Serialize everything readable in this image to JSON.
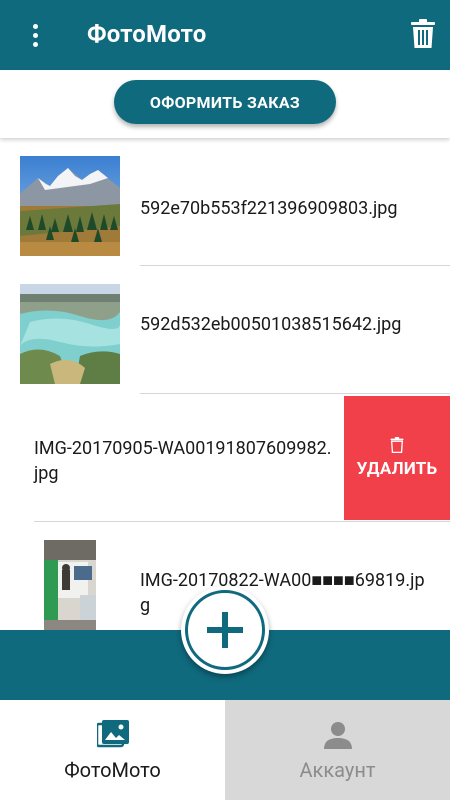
{
  "app": {
    "title": "ФотоМото"
  },
  "header": {
    "menu_icon": "more-vertical-icon",
    "delete_all_icon": "trash-icon"
  },
  "order": {
    "button_label": "ОФОРМИТЬ ЗАКАЗ"
  },
  "files": [
    {
      "name": "592e70b553f221396909803.jpg",
      "thumbnail": "mountain-landscape"
    },
    {
      "name": "592d532eb00501038515642.jpg",
      "thumbnail": "lake-aerial-view"
    },
    {
      "name": "IMG-20170905-WA00191807609982.jpg",
      "thumbnail": "none",
      "swipe_action": "УДАЛИТЬ"
    },
    {
      "name": "IMG-20170822-WA00■■■■69819.jpg",
      "thumbnail": "office-interior"
    }
  ],
  "row_action": {
    "delete_label": "УДАЛИТЬ",
    "icon": "trash-icon"
  },
  "fab": {
    "icon": "plus-icon"
  },
  "bottom_nav": [
    {
      "label": "ФотоМото",
      "icon": "photos-icon",
      "active": true
    },
    {
      "label": "Аккаунт",
      "icon": "person-icon",
      "active": false
    }
  ],
  "colors": {
    "primary": "#0f6a7e",
    "danger": "#f2404a",
    "inactive_tab": "#d8d8d8"
  }
}
